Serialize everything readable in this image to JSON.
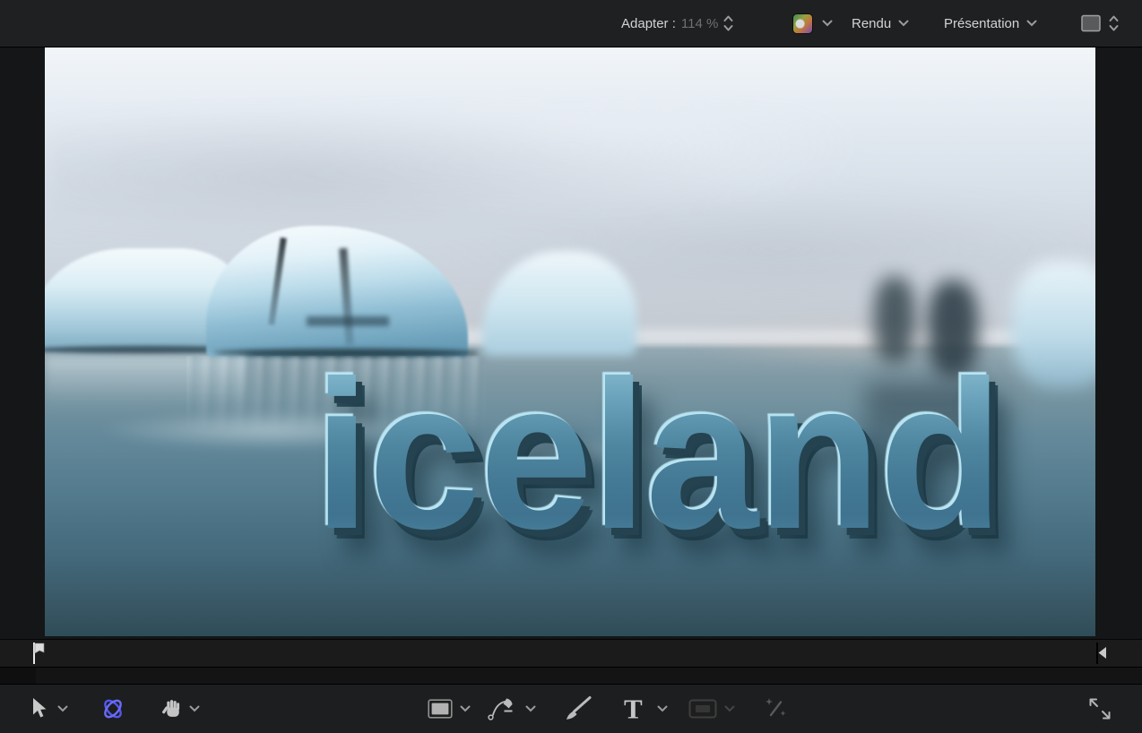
{
  "top_toolbar": {
    "zoom_control": {
      "label": "Adapter :",
      "value": "114 %"
    },
    "render_menu_label": "Rendu",
    "view_menu_label": "Présentation"
  },
  "viewer": {
    "title_text": "iceland"
  },
  "tools": {
    "text_tool_glyph": "T"
  },
  "icons": {
    "color_swatch": "gradient-square",
    "select_tool": "arrow-cursor",
    "transform_3d_tool": "blue-orbit-ellipses",
    "pan_tool": "hand",
    "rectangle_tool": "filled-rounded-rect",
    "bezier_tool": "pen-nib-with-curve",
    "paint_stroke_tool": "brush",
    "text_tool": "T",
    "shape_mask_tool": "rect-outline-dimmed",
    "apply_effect_tool": "magic-wand-dimmed",
    "expand_view": "diagonal-resize-arrows",
    "playhead": "flag-marker",
    "range_end": "left-triangle-marker",
    "display_select": "gray-square-stepper"
  },
  "colors": {
    "accent_tool_blue": "#5558ee",
    "toolbar_bg": "#1f2021",
    "canvas_bg": "#151617",
    "title_fill": "#4f86a0",
    "title_highlight": "#b9e4f2",
    "water_deep": "#2f4c59",
    "sky_light": "#f2f5f8"
  }
}
